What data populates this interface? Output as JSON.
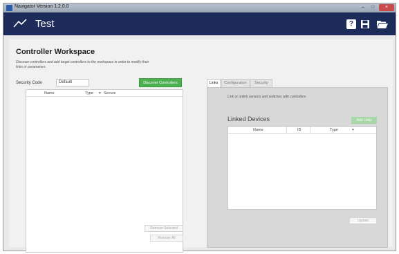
{
  "titlebar": {
    "text": "Navigator Version 1.2.0.0",
    "minimize": "–",
    "maximize": "□",
    "close": "×"
  },
  "header": {
    "title": "Test",
    "help_label": "?"
  },
  "workspace": {
    "title": "Controller Workspace",
    "description": "Discover controllers and add target controllers to the workspace in order to modify their links or parameters.",
    "security_code_label": "Security Code",
    "security_code_value": "Default",
    "discover_button": "Discover Controllers",
    "columns": [
      "Name",
      "Type",
      "Secure"
    ],
    "remove_selected_button": "Remove Selected",
    "remove_all_button": "Remove All"
  },
  "tabs": [
    "Links",
    "Configuration",
    "Security"
  ],
  "links_panel": {
    "description": "Link or unlink sensors and switches with controllers",
    "linked_devices_title": "Linked Devices",
    "add_links_button": "Add Links",
    "columns": [
      "Name",
      "ID",
      "Type"
    ],
    "update_button": "Update"
  },
  "icons": {
    "brand": "brand-logo-icon",
    "help": "help-icon",
    "save": "save-icon",
    "open": "folder-open-icon",
    "filter": "filter-icon"
  },
  "colors": {
    "header_bg": "#1c2b5a",
    "primary_green": "#4caf50",
    "disabled_green": "#a8d8a8"
  }
}
